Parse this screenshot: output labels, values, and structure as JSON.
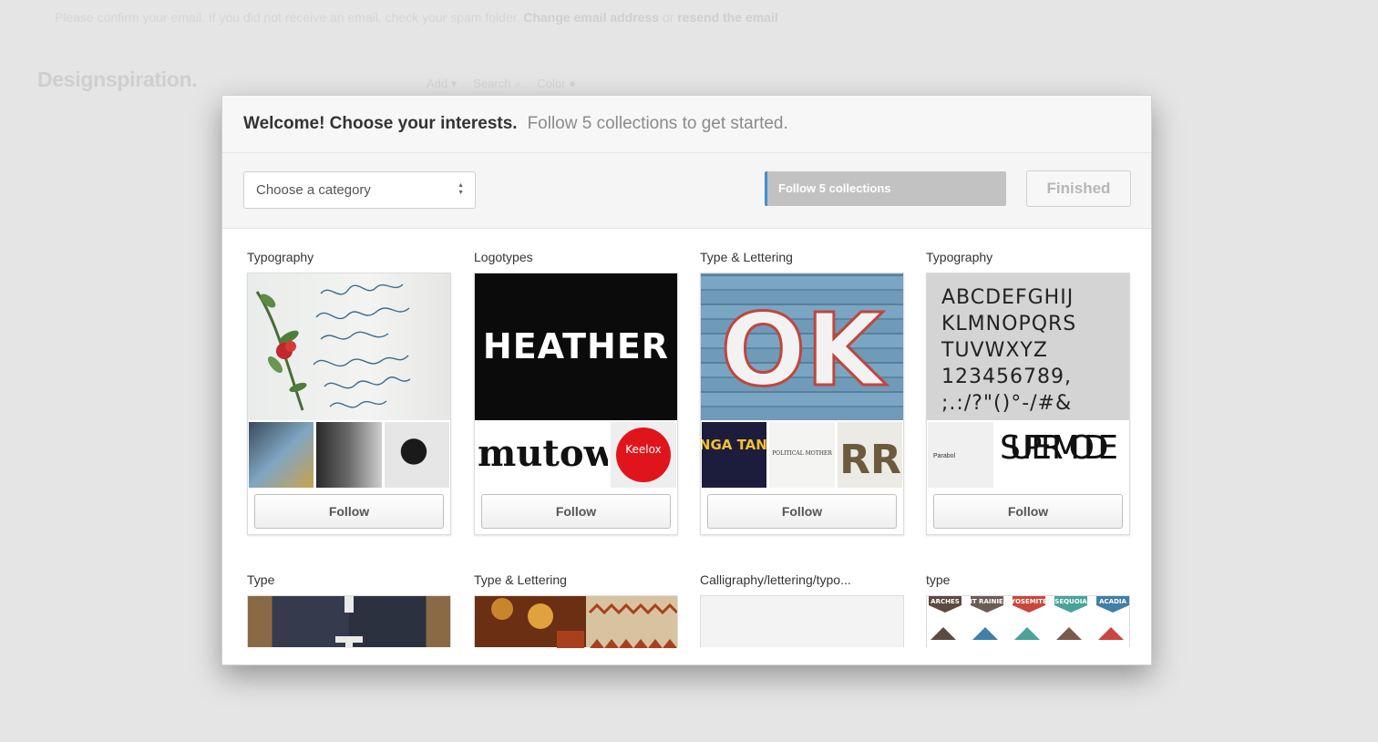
{
  "background": {
    "notice_text": "Please confirm your email. If you did not receive an email, check your spam folder.",
    "notice_link1": "Change email address",
    "notice_or": "or",
    "notice_link2": "resend the email",
    "logo": "Designspiration.",
    "nav": [
      "Add",
      "Search",
      "Color"
    ]
  },
  "modal": {
    "title": "Welcome! Choose your interests.",
    "subtitle": "Follow 5 collections to get started.",
    "category_select": "Choose a category",
    "follow_progress": "Follow 5 collections",
    "finished": "Finished"
  },
  "collections": [
    {
      "title": "Typography",
      "follow": "Follow",
      "art_text": "I love you so much most beautiful darling",
      "thumb_texts": []
    },
    {
      "title": "Logotypes",
      "follow": "Follow",
      "art_text": "HEATHER",
      "thumb_texts": [
        "mutowla",
        "Keelox"
      ]
    },
    {
      "title": "Type & Lettering",
      "follow": "Follow",
      "art_text": "OK",
      "thumb_texts": [
        "TANGA TANGA",
        "POLITICAL MOTHER",
        "RR"
      ]
    },
    {
      "title": "Typography",
      "follow": "Follow",
      "art_text": "ABCDEFGHIJ KLMNOPQRS TUVWXYZ 123456789, ;.:/?\"()°-/#&",
      "thumb_texts": [
        "Parabol",
        "SUPER MODE"
      ]
    },
    {
      "title": "Type"
    },
    {
      "title": "Type & Lettering"
    },
    {
      "title": "Calligraphy/lettering/typo..."
    },
    {
      "title": "type",
      "art_labels": [
        "ARCHES",
        "MT RAINIER",
        "YOSEMITE",
        "SEQUOIA",
        "ACADIA"
      ]
    }
  ],
  "colors": {
    "accent": "#3d8fd4",
    "progress_bg": "#c2c2c2",
    "backdrop": "#e5e5e5"
  }
}
